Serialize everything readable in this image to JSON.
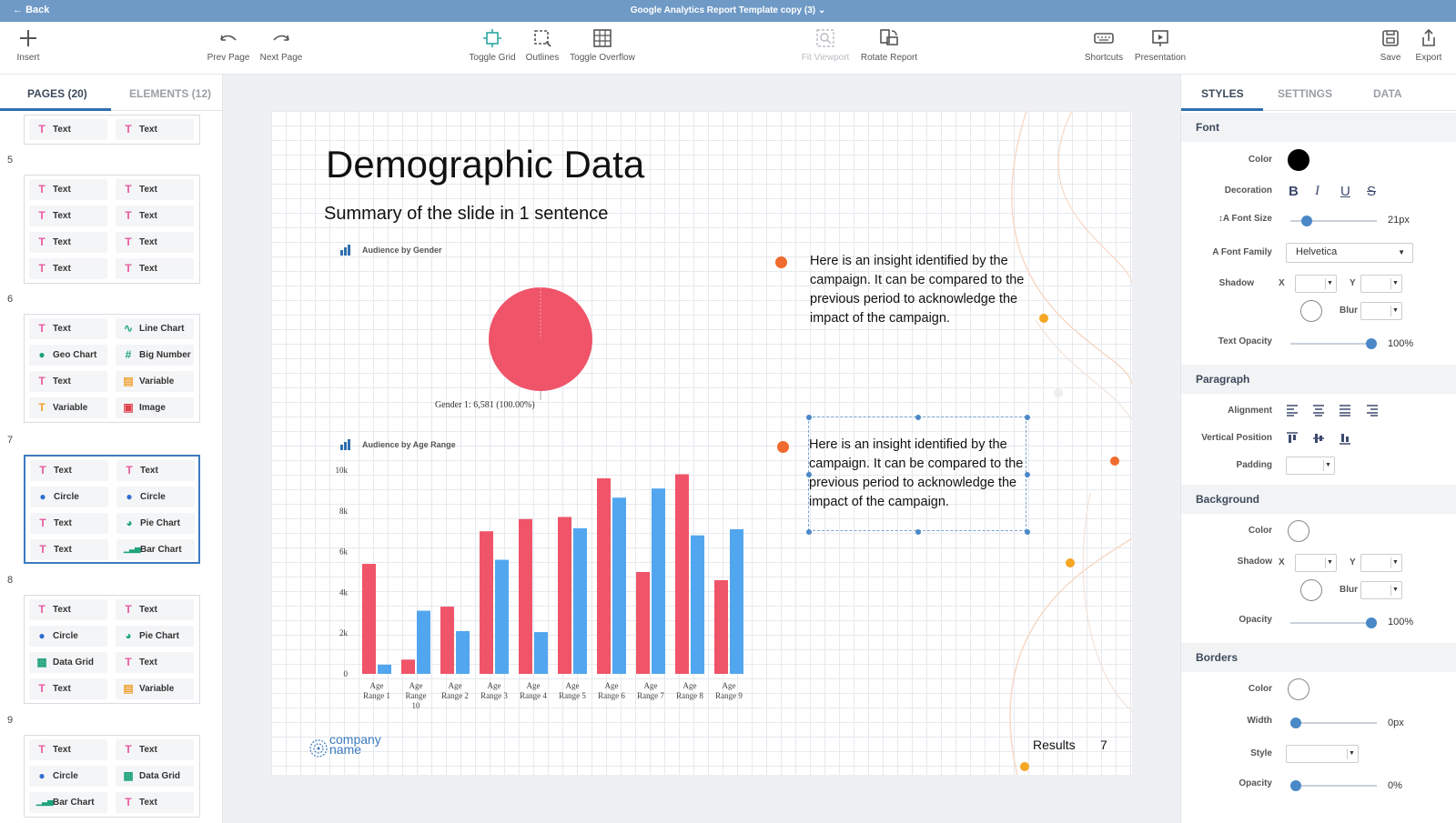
{
  "topbar": {
    "back_label": "Back",
    "title": "Google Analytics Report Template copy (3)"
  },
  "toolbar": {
    "insert": "Insert",
    "prev_page": "Prev Page",
    "next_page": "Next Page",
    "toggle_grid": "Toggle Grid",
    "outlines": "Outlines",
    "toggle_overflow": "Toggle Overflow",
    "fit_viewport": "Fit Viewport",
    "rotate_report": "Rotate Report",
    "shortcuts": "Shortcuts",
    "presentation": "Presentation",
    "save": "Save",
    "export": "Export"
  },
  "left": {
    "tabs": [
      "PAGES (20)",
      "ELEMENTS (12)"
    ],
    "pages": [
      {
        "num": "",
        "items": [
          {
            "icon": "text-icon",
            "label": "Text"
          },
          {
            "icon": "text-icon",
            "label": "Text"
          }
        ]
      },
      {
        "num": "5",
        "items": [
          {
            "icon": "text-icon",
            "label": "Text"
          },
          {
            "icon": "text-icon",
            "label": "Text"
          },
          {
            "icon": "text-icon",
            "label": "Text"
          },
          {
            "icon": "text-icon",
            "label": "Text"
          },
          {
            "icon": "text-icon",
            "label": "Text"
          },
          {
            "icon": "text-icon",
            "label": "Text"
          },
          {
            "icon": "text-icon",
            "label": "Text"
          },
          {
            "icon": "text-icon",
            "label": "Text"
          }
        ]
      },
      {
        "num": "6",
        "items": [
          {
            "icon": "text-icon",
            "label": "Text"
          },
          {
            "icon": "line-chart-icon",
            "label": "Line Chart"
          },
          {
            "icon": "geo-chart-icon",
            "label": "Geo Chart"
          },
          {
            "icon": "big-number-icon",
            "label": "Big Number"
          },
          {
            "icon": "text-icon",
            "label": "Text"
          },
          {
            "icon": "variable-icon",
            "label": "Variable"
          },
          {
            "icon": "variable-text-icon",
            "label": "Variable"
          },
          {
            "icon": "image-icon",
            "label": "Image"
          }
        ]
      },
      {
        "num": "7",
        "items": [
          {
            "icon": "text-icon",
            "label": "Text"
          },
          {
            "icon": "text-icon",
            "label": "Text"
          },
          {
            "icon": "circle-icon",
            "label": "Circle"
          },
          {
            "icon": "circle-icon",
            "label": "Circle"
          },
          {
            "icon": "text-icon",
            "label": "Text"
          },
          {
            "icon": "pie-chart-icon",
            "label": "Pie Chart"
          },
          {
            "icon": "text-icon",
            "label": "Text"
          },
          {
            "icon": "bar-chart-icon",
            "label": "Bar Chart"
          }
        ]
      },
      {
        "num": "8",
        "items": [
          {
            "icon": "text-icon",
            "label": "Text"
          },
          {
            "icon": "text-icon",
            "label": "Text"
          },
          {
            "icon": "circle-icon",
            "label": "Circle"
          },
          {
            "icon": "pie-chart-icon",
            "label": "Pie Chart"
          },
          {
            "icon": "data-grid-icon",
            "label": "Data Grid"
          },
          {
            "icon": "text-icon",
            "label": "Text"
          },
          {
            "icon": "text-icon",
            "label": "Text"
          },
          {
            "icon": "variable-icon",
            "label": "Variable"
          }
        ]
      },
      {
        "num": "9",
        "items": [
          {
            "icon": "text-icon",
            "label": "Text"
          },
          {
            "icon": "text-icon",
            "label": "Text"
          },
          {
            "icon": "circle-icon",
            "label": "Circle"
          },
          {
            "icon": "data-grid-icon",
            "label": "Data Grid"
          },
          {
            "icon": "bar-chart-icon",
            "label": "Bar Chart"
          },
          {
            "icon": "text-icon",
            "label": "Text"
          }
        ]
      }
    ]
  },
  "slide": {
    "title": "Demographic Data",
    "subtitle": "Summary of the slide in 1 sentence",
    "insight1": "Here is an insight identified by the campaign. It can be compared to the previous period to acknowledge the impact of the campaign.",
    "insight2": "Here is an insight identified by the campaign. It can be compared to the previous period to acknowledge the impact of the campaign.",
    "results_label": "Results",
    "page_number": "7",
    "logo_line1": "company",
    "logo_line2": "name"
  },
  "chart_data": [
    {
      "type": "pie",
      "title": "Audience by Gender",
      "categories": [
        "Gender 1"
      ],
      "values": [
        6581
      ],
      "data_label": "Gender 1: 6,581 (100.00%)",
      "colors": [
        "#ef5469"
      ]
    },
    {
      "type": "bar",
      "title": "Audience by Age Range",
      "categories": [
        "Age Range 1",
        "Age Range 10",
        "Age Range 2",
        "Age Range 3",
        "Age Range 4",
        "Age Range 5",
        "Age Range 6",
        "Age Range 7",
        "Age Range 8",
        "Age Range 9"
      ],
      "yticks": [
        "0",
        "2k",
        "4k",
        "6k",
        "8k",
        "10k"
      ],
      "ylim": [
        0,
        10000
      ],
      "series": [
        {
          "color": "#ef5469",
          "values": [
            5400,
            700,
            3300,
            7000,
            7600,
            7700,
            9600,
            5000,
            9800,
            4600
          ]
        },
        {
          "color": "#52a6ef",
          "values": [
            450,
            3100,
            2100,
            5600,
            2050,
            7150,
            8650,
            9100,
            6800,
            7100
          ]
        }
      ]
    }
  ],
  "right": {
    "tabs": [
      "STYLES",
      "SETTINGS",
      "DATA"
    ],
    "font": {
      "section": "Font",
      "color_label": "Color",
      "decoration_label": "Decoration",
      "font_size_label": "Font Size",
      "font_size_value": "21px",
      "font_family_label": "Font Family",
      "font_family_value": "Helvetica",
      "shadow_label": "Shadow",
      "x_label": "X",
      "y_label": "Y",
      "blur_label": "Blur",
      "text_opacity_label": "Text Opacity",
      "text_opacity_value": "100%",
      "color": "#000000",
      "font_size_level": 0.15,
      "text_opacity_level": 1.0
    },
    "paragraph": {
      "section": "Paragraph",
      "alignment_label": "Alignment",
      "vertical_label": "Vertical Position",
      "padding_label": "Padding"
    },
    "background": {
      "section": "Background",
      "color_label": "Color",
      "shadow_label": "Shadow",
      "x_label": "X",
      "y_label": "Y",
      "blur_label": "Blur",
      "opacity_label": "Opacity",
      "opacity_value": "100%",
      "opacity_level": 1.0
    },
    "borders": {
      "section": "Borders",
      "color_label": "Color",
      "width_label": "Width",
      "width_value": "0px",
      "style_label": "Style",
      "opacity_label": "Opacity",
      "opacity_value": "0%",
      "width_level": 0.0,
      "opacity_level": 0.0
    }
  }
}
